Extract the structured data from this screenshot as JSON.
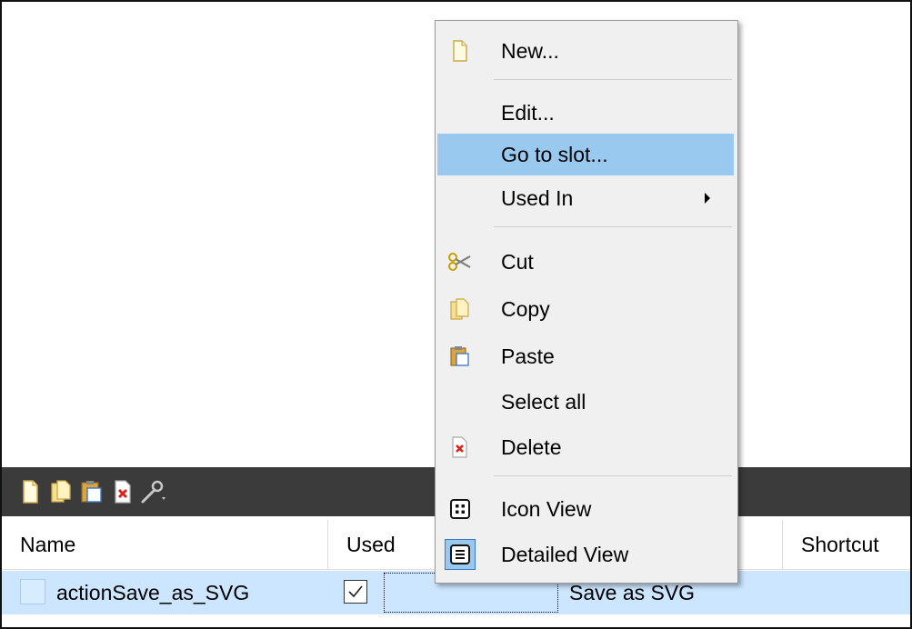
{
  "menu": {
    "items": {
      "new": "New...",
      "edit": "Edit...",
      "goto_slot": "Go to slot...",
      "used_in": "Used In",
      "cut": "Cut",
      "copy": "Copy",
      "paste": "Paste",
      "select_all": "Select all",
      "delete": "Delete",
      "icon_view": "Icon View",
      "detailed_view": "Detailed View"
    },
    "highlighted": "goto_slot"
  },
  "table": {
    "columns": {
      "name": "Name",
      "used": "Used",
      "shortcut": "Shortcut"
    },
    "rows": [
      {
        "name": "actionSave_as_SVG",
        "used": true,
        "text": "Save as SVG"
      }
    ]
  },
  "icons": {
    "toolbar": [
      "new-icon",
      "copy-icon",
      "paste-icon",
      "delete-icon",
      "configure-icon"
    ]
  },
  "colors": {
    "menu_highlight": "#99c9ef",
    "row_selected": "#cce6ff",
    "toolbar_bg": "#3b3b3b",
    "delete_red": "#d9231e"
  }
}
